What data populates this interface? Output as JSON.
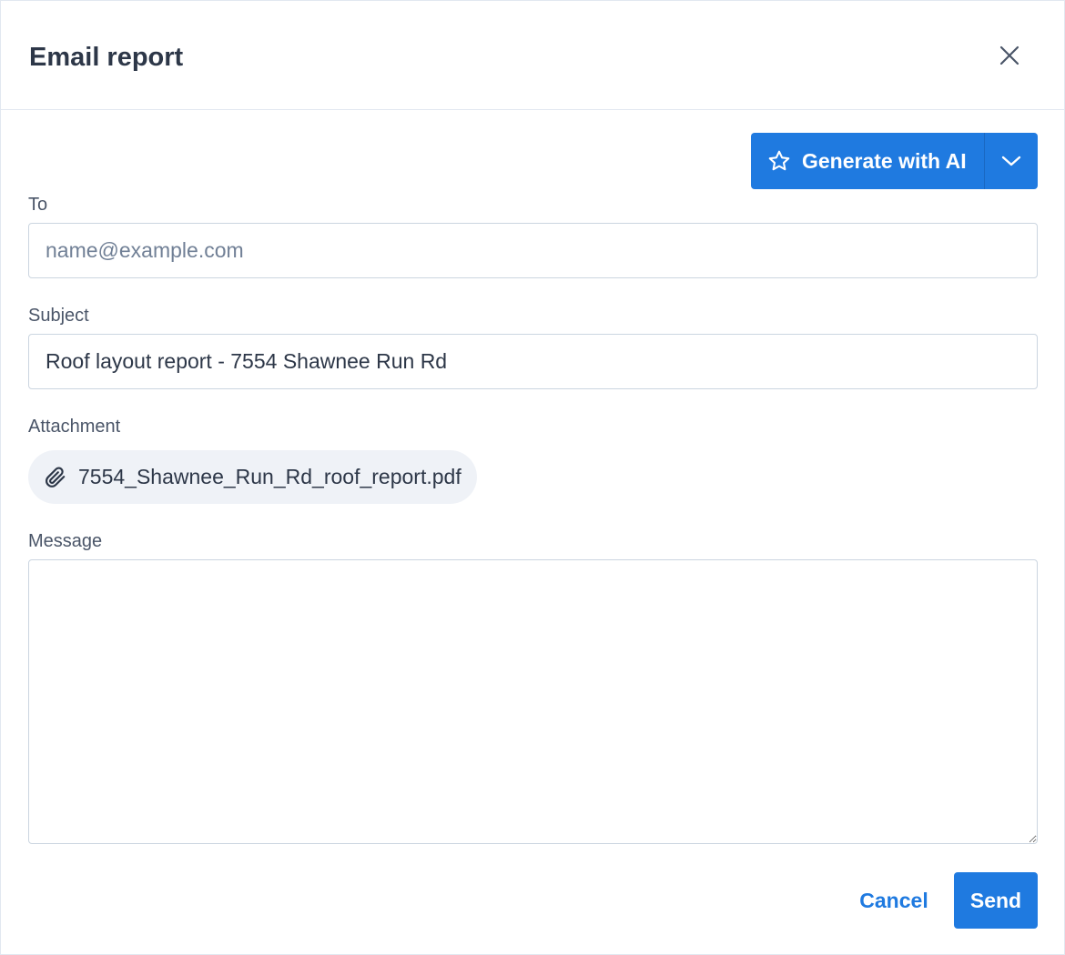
{
  "dialog": {
    "title": "Email report",
    "close_icon": "close-icon"
  },
  "ai": {
    "label": "Generate with AI",
    "icon": "star-icon",
    "menu_icon": "chevron-down-icon"
  },
  "to": {
    "label": "To",
    "value": "",
    "placeholder": "name@example.com"
  },
  "subject": {
    "label": "Subject",
    "value": "Roof layout report - 7554 Shawnee Run Rd"
  },
  "attachment": {
    "label": "Attachment",
    "filename": "7554_Shawnee_Run_Rd_roof_report.pdf",
    "icon": "paperclip-icon"
  },
  "message": {
    "label": "Message",
    "value": ""
  },
  "footer": {
    "cancel_label": "Cancel",
    "send_label": "Send"
  },
  "colors": {
    "accent": "#1f7ae0",
    "text": "#2d3748",
    "label": "#4a5568",
    "border": "#cbd5e0",
    "chip_bg": "#eff2f7"
  }
}
